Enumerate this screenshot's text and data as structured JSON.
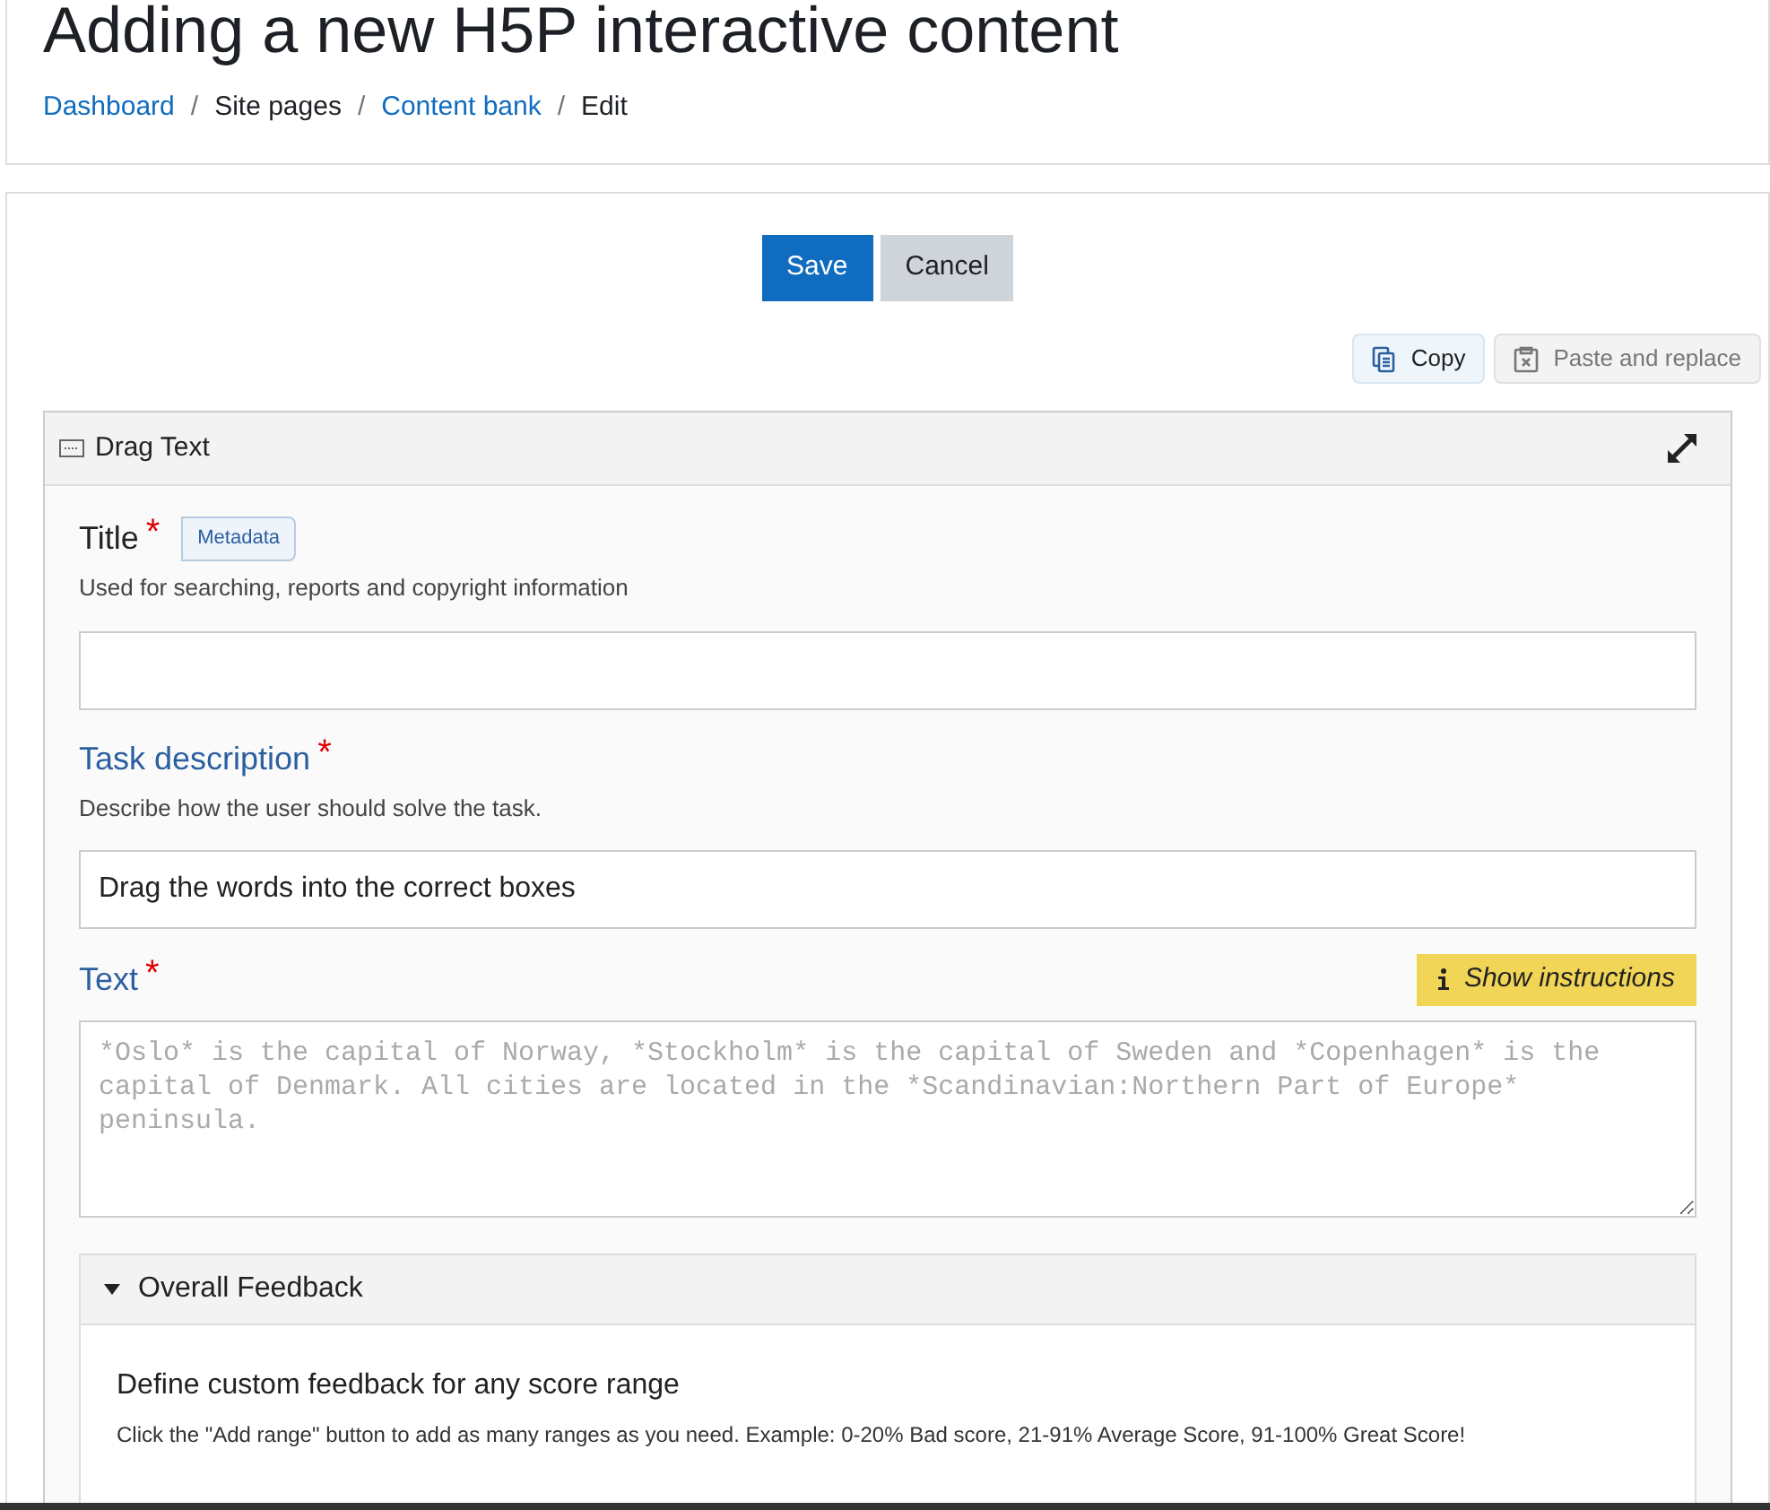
{
  "page_title": "Adding a new H5P interactive content",
  "breadcrumb": [
    {
      "label": "Dashboard",
      "link": true
    },
    {
      "label": "Site pages",
      "link": false
    },
    {
      "label": "Content bank",
      "link": true
    },
    {
      "label": "Edit",
      "link": false
    }
  ],
  "breadcrumb_separator": "/",
  "actions": {
    "save": "Save",
    "cancel": "Cancel"
  },
  "clipboard": {
    "copy": "Copy",
    "paste": "Paste and replace",
    "paste_disabled": true
  },
  "editor": {
    "title": "Drag Text",
    "fields": [
      {
        "kind": "input",
        "label": "Title",
        "required_mark": "*",
        "badge": "Metadata",
        "description": "Used for searching, reports and copyright information"
      },
      {
        "kind": "input",
        "label": "Task description",
        "required_mark": "*",
        "description": "Describe how the user should solve the task.",
        "value": "Drag the words into the correct boxes"
      },
      {
        "kind": "textarea",
        "label": "Text",
        "required_mark": "*",
        "button": "Show instructions",
        "placeholder": "*Oslo* is the capital of Norway, *Stockholm* is the capital of Sweden and *Copenhagen* is the capital of Denmark. All cities are located in the *Scandinavian:Northern Part of Europe* peninsula."
      }
    ],
    "group": {
      "title": "Overall Feedback",
      "expanded": true,
      "heading": "Define custom feedback for any score range",
      "description": "Click the \"Add range\" button to add as many ranges as you need. Example: 0-20% Bad score, 21-91% Average Score, 91-100% Great Score!"
    }
  }
}
